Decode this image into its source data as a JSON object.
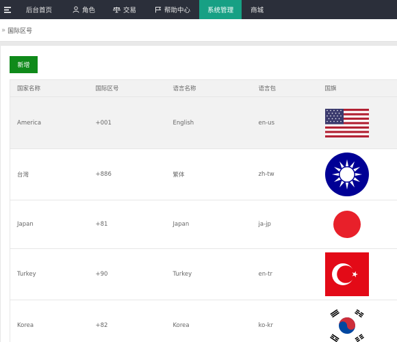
{
  "nav": {
    "items": [
      {
        "label": "后台首页"
      },
      {
        "label": "角色"
      },
      {
        "label": "交易"
      },
      {
        "label": "帮助中心"
      },
      {
        "label": "系统管理"
      },
      {
        "label": "商城"
      }
    ]
  },
  "breadcrumb": {
    "current": "国际区号"
  },
  "toolbar": {
    "add_label": "新增"
  },
  "table": {
    "columns": [
      "国家名称",
      "国际区号",
      "语言名称",
      "语言包",
      "国旗"
    ],
    "rows": [
      {
        "country": "America",
        "code": "+001",
        "language": "English",
        "pack": "en-us",
        "flag": "usa-flag"
      },
      {
        "country": "台灣",
        "code": "+886",
        "language": "繁体",
        "pack": "zh-tw",
        "flag": "roc-blue-sky-white-sun-flag"
      },
      {
        "country": "Japan",
        "code": "+81",
        "language": "Japan",
        "pack": "ja-jp",
        "flag": "japan-flag"
      },
      {
        "country": "Turkey",
        "code": "+90",
        "language": "Turkey",
        "pack": "en-tr",
        "flag": "turkey-flag"
      },
      {
        "country": "Korea",
        "code": "+82",
        "language": "Korea",
        "pack": "ko-kr",
        "flag": "korea-flag"
      }
    ]
  },
  "colors": {
    "nav_bg": "#2b2f3a",
    "nav_active": "#17a084",
    "add_button": "#0f8a1a"
  }
}
